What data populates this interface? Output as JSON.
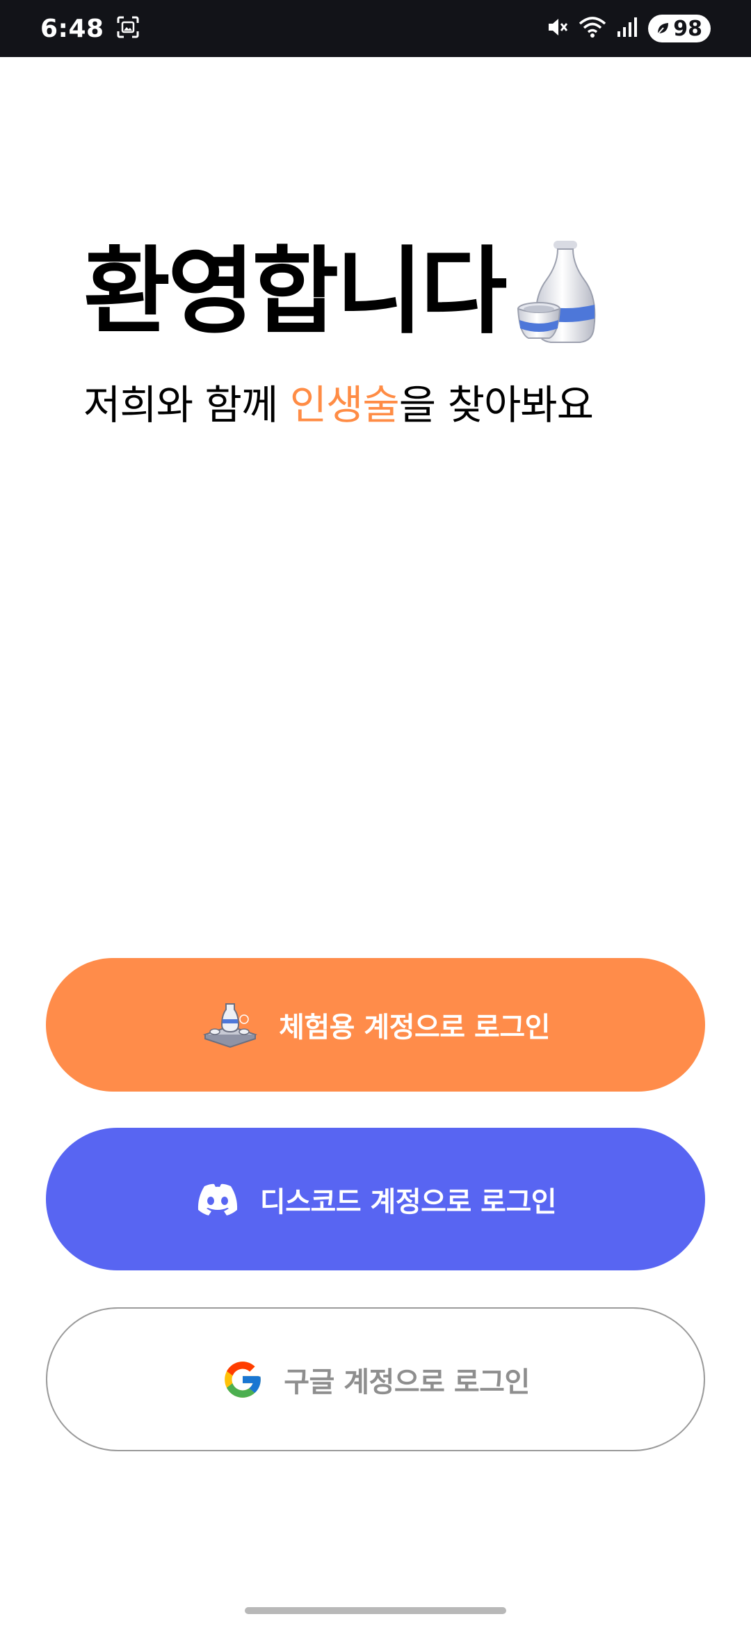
{
  "status_bar": {
    "time": "6:48",
    "battery": "98",
    "icons": [
      "screenshot-icon",
      "mute-icon",
      "wifi-icon",
      "signal-icon",
      "battery-icon"
    ]
  },
  "welcome": {
    "title": "환영합니다",
    "subtitle_prefix": "저희와 함께 ",
    "subtitle_accent": "인생술",
    "subtitle_suffix": "을 찾아봐요",
    "accent_color": "#ff8c45"
  },
  "buttons": {
    "trial": {
      "label": "체험용 계정으로 로그인",
      "color": "#ff8c4a"
    },
    "discord": {
      "label": "디스코드 계정으로 로그인",
      "color": "#5865f2"
    },
    "google": {
      "label": "구글 계정으로 로그인",
      "color": "#ffffff"
    }
  }
}
